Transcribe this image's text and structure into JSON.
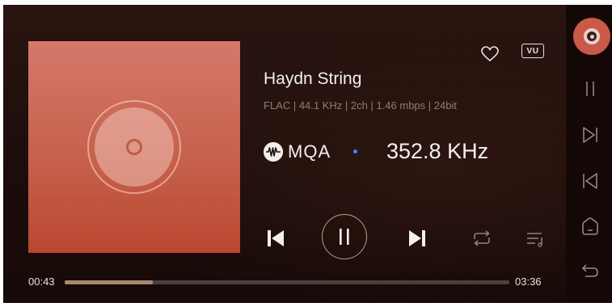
{
  "track": {
    "title": "Haydn String",
    "format_info": "FLAC  |  44.1 KHz  |  2ch  |  1.46 mbps  |  24bit",
    "mqa_label": "MQA",
    "sample_rate": "352.8 KHz"
  },
  "controls": {
    "vu_label": "VU"
  },
  "progress": {
    "elapsed": "00:43",
    "total": "03:36",
    "fraction": 0.199
  },
  "colors": {
    "accent_bronze": "#c49b85",
    "cover_coral": "#c95a47",
    "mqa_dot_blue": "#2f8cff",
    "progress_fill": "#a8896f"
  },
  "icons": {
    "favorite": "heart-icon",
    "vu": "vu-meter-icon",
    "previous": "skip-previous-icon",
    "play_pause": "pause-icon",
    "next": "skip-next-icon",
    "repeat": "repeat-icon",
    "playlist": "playlist-icon",
    "side_pause": "pause-icon",
    "side_next": "next-icon",
    "side_prev": "previous-icon",
    "home": "home-icon",
    "back": "back-icon"
  }
}
